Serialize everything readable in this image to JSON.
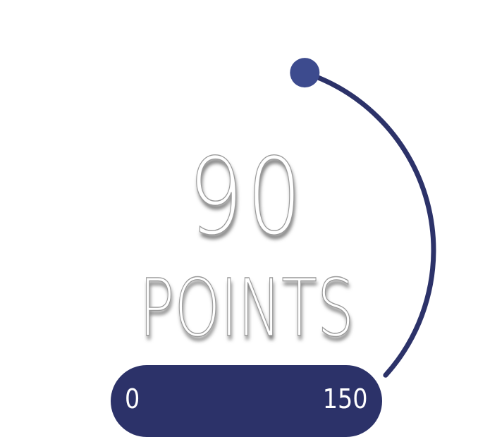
{
  "gauge": {
    "value": "90",
    "unit": "POINTS",
    "min": "0",
    "max": "150",
    "value_fraction": 0.6
  },
  "colors": {
    "arc": "#2c3269",
    "handle": "#3d4b8e",
    "pill": "#2c3269",
    "text": "#ffffff",
    "background": "#ffffff"
  }
}
